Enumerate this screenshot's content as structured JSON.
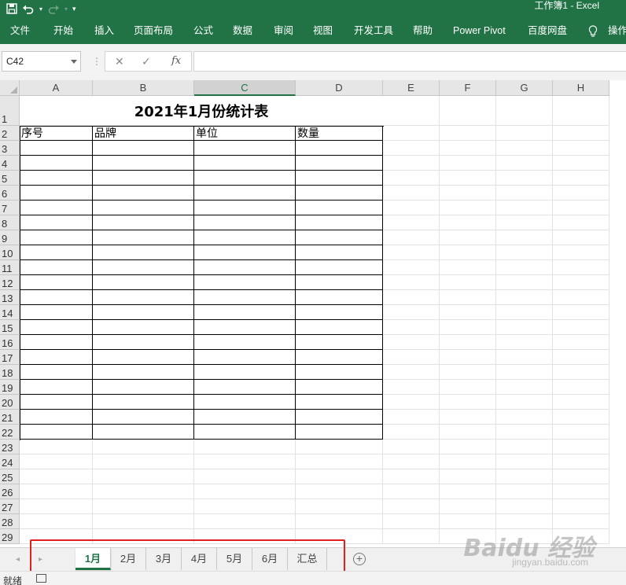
{
  "window": {
    "title": "工作簿1  -  Excel"
  },
  "ribbon": {
    "tabs": [
      "文件",
      "开始",
      "插入",
      "页面布局",
      "公式",
      "数据",
      "审阅",
      "视图",
      "开发工具",
      "帮助",
      "Power Pivot",
      "百度网盘",
      "操作"
    ]
  },
  "formula_bar": {
    "name_box": "C42",
    "fx_label": "fx",
    "value": ""
  },
  "columns": [
    "A",
    "B",
    "C",
    "D",
    "E",
    "F",
    "G",
    "H"
  ],
  "selected_column": "C",
  "rows": [
    "1",
    "2",
    "3",
    "4",
    "5",
    "6",
    "7",
    "8",
    "9",
    "10",
    "11",
    "12",
    "13",
    "14",
    "15",
    "16",
    "17",
    "18",
    "19",
    "20",
    "21",
    "22",
    "23",
    "24",
    "25",
    "26",
    "27",
    "28",
    "29"
  ],
  "sheet": {
    "title": "2021年1月份统计表",
    "headers": [
      "序号",
      "品牌",
      "单位",
      "数量"
    ]
  },
  "sheet_tabs": [
    "1月",
    "2月",
    "3月",
    "4月",
    "5月",
    "6月",
    "汇总"
  ],
  "active_sheet": "1月",
  "status": {
    "ready": "就绪"
  },
  "watermark": {
    "brand": "Baidu 经验",
    "url": "jingyan.baidu.com"
  },
  "colors": {
    "accent": "#217346",
    "highlight_box": "#e02020"
  }
}
